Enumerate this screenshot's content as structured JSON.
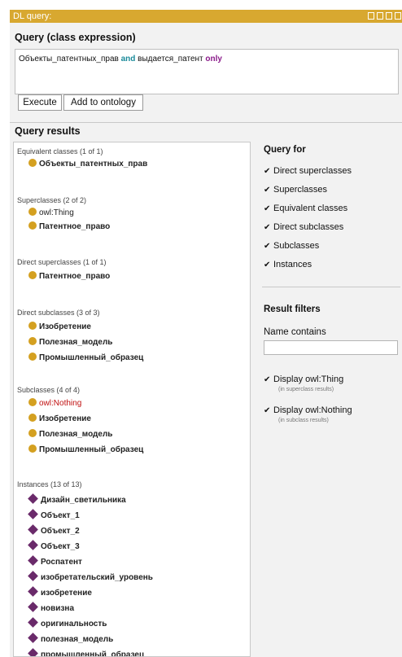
{
  "window": {
    "title": "DL query:"
  },
  "query": {
    "heading": "Query (class expression)",
    "part1": "Объекты_патентных_прав ",
    "kw_and": "and",
    "part2": " выдается_патент ",
    "kw_only": "only"
  },
  "buttons": {
    "execute": "Execute",
    "add": "Add to ontology"
  },
  "results": {
    "heading": "Query results",
    "groups": [
      {
        "title": "Equivalent classes (1 of 1)",
        "items": [
          "Объекты_патентных_прав"
        ]
      },
      {
        "title": "Superclasses (2 of 2)",
        "items": [
          "owl:Thing",
          "Патентное_право"
        ]
      },
      {
        "title": "Direct superclasses (1 of 1)",
        "items": [
          "Патентное_право"
        ]
      },
      {
        "title": "Direct subclasses (3 of 3)",
        "items": [
          "Изобретение",
          "Полезная_модель",
          "Промышленный_образец"
        ]
      },
      {
        "title": "Subclasses (4 of 4)",
        "items": [
          "owl:Nothing",
          "Изобретение",
          "Полезная_модель",
          "Промышленный_образец"
        ]
      },
      {
        "title": "Instances (13 of 13)",
        "items": [
          "Дизайн_светильника",
          "Объект_1",
          "Объект_2",
          "Объект_3",
          "Роспатент",
          "изобретательский_уровень",
          "изобретение",
          "новизна",
          "оригинальность",
          "полезная_модель",
          "промышленный_образец"
        ]
      }
    ]
  },
  "query_for": {
    "heading": "Query for",
    "options": [
      "Direct superclasses",
      "Superclasses",
      "Equivalent classes",
      "Direct subclasses",
      "Subclasses",
      "Instances"
    ]
  },
  "filters": {
    "heading": "Result filters",
    "name_label": "Name contains",
    "name_value": "",
    "thing_label": "Display owl:Thing",
    "thing_sub": "(in superclass results)",
    "nothing_label": "Display owl:Nothing",
    "nothing_sub": "(in subclass results)"
  },
  "icons": {
    "class_icon": "class-circle-icon",
    "instance_icon": "individual-diamond-icon",
    "check_icon": "checkmark-icon"
  },
  "colors": {
    "titlebar": "#d8a830",
    "class": "#d4a020",
    "instance": "#6a2a6a",
    "keyword_and": "#1a8a9a",
    "keyword_only": "#8a1a8a",
    "nothing": "#c01010"
  }
}
